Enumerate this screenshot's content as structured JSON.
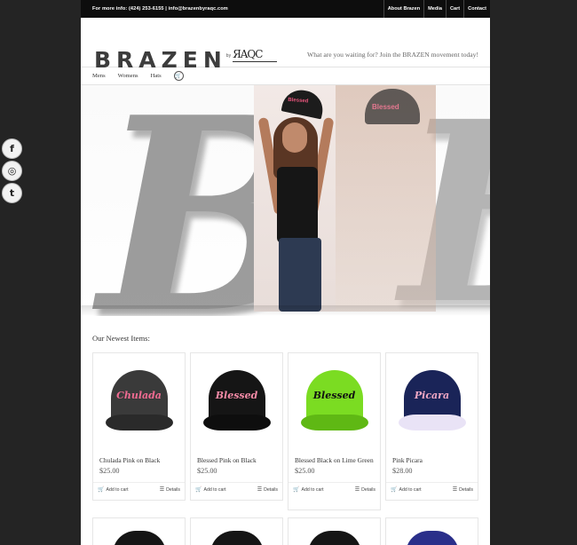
{
  "topbar": {
    "info": "For more info: (424) 253-6155  |  info@brazenbyraqc.com",
    "links": [
      "About Brazen",
      "Media",
      "Cart",
      "Contact"
    ]
  },
  "header": {
    "logo_word": "BRAZEN",
    "logo_by": "by",
    "logo_mark": "ЯAQC",
    "tagline": "What are you waiting for? Join the BRAZEN movement today!"
  },
  "nav": {
    "items": [
      "Mens",
      "Womens",
      "Hats"
    ],
    "cart_icon": "cart-icon"
  },
  "social": {
    "icons": [
      "facebook-icon",
      "instagram-icon",
      "twitter-icon"
    ],
    "glyphs": [
      "f",
      "◎",
      "t"
    ]
  },
  "hero": {
    "letters": [
      "B",
      "B"
    ],
    "cap_text": "Blessed",
    "ghost_cap_text": "Blessed"
  },
  "section": {
    "title": "Our Newest Items:"
  },
  "products": [
    {
      "name": "Chulada Pink on Black",
      "price": "$25.00",
      "cap_text": "Chulada",
      "crown": "#3a3a3a",
      "brim": "#2a2a2a",
      "text_color": "#f06b92"
    },
    {
      "name": "Blessed Pink on Black",
      "price": "$25.00",
      "cap_text": "Blessed",
      "crown": "#151515",
      "brim": "#0e0e0e",
      "text_color": "#f28aa6"
    },
    {
      "name": "Blessed Black on Lime Green",
      "price": "$25.00",
      "cap_text": "Blessed",
      "crown": "#7bdc22",
      "brim": "#5fb814",
      "text_color": "#111111"
    },
    {
      "name": "Pink Picara",
      "price": "$28.00",
      "cap_text": "Picara",
      "crown": "#1a2458",
      "brim": "#e9e3f6",
      "text_color": "#f0a7c4"
    }
  ],
  "actions": {
    "add": "Add to cart",
    "details": "Details"
  }
}
